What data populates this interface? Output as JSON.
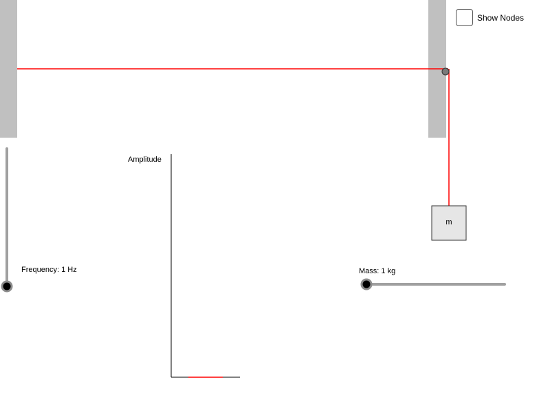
{
  "show_nodes": {
    "label": "Show Nodes",
    "checked": false
  },
  "mass_block": {
    "label": "m"
  },
  "frequency_slider": {
    "label": "Frequency: 1 Hz",
    "value": 0
  },
  "mass_slider": {
    "label": "Mass: 1 kg",
    "value": 0
  },
  "amplitude_chart": {
    "ylabel": "Amplitude"
  },
  "colors": {
    "string": "#ff0000",
    "wall": "#c0c0c0",
    "slider_track": "#a0a0a0",
    "knob_fill": "#000000",
    "knob_ring": "#8c8c8c",
    "mass_fill": "#e6e6e6",
    "pulley": "#7a7a7a"
  }
}
